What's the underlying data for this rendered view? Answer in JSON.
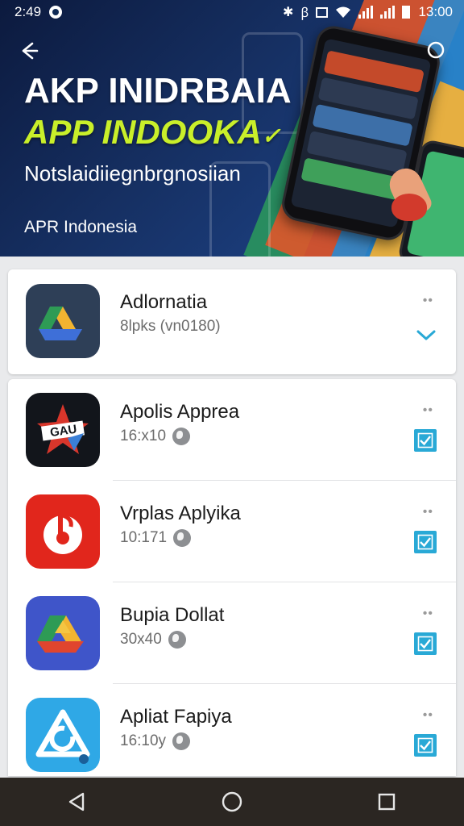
{
  "status_bar": {
    "time": "2:49",
    "clock": "13:00"
  },
  "banner": {
    "title_line_1": "AKP INIDRBAIA",
    "title_line_2": "APP INDOOKA",
    "subtitle": "Notslaidiiegnbrgnosiian",
    "caption": "APR Indonesia"
  },
  "top_item": {
    "name": "Adlornatia",
    "meta": "8lpks (vn0180)",
    "more": "••",
    "icon": "drive-triangle-icon"
  },
  "apps": [
    {
      "name": "Apolis Apprea",
      "meta": "16:x10",
      "icon": "star-tag-icon",
      "checked": true
    },
    {
      "name": "Vrplas Aplyika",
      "meta": "10:171",
      "icon": "music-note-icon",
      "checked": true
    },
    {
      "name": "Bupia Dollat",
      "meta": "30x40",
      "icon": "drive-triangle-icon",
      "checked": true
    },
    {
      "name": "Apliat Fapiya",
      "meta": "16:10y",
      "icon": "triangle-clock-icon",
      "checked": true
    }
  ],
  "colors": {
    "accent": "#29a9d6",
    "banner_bg": "#163063",
    "title_green": "#c9ef2a",
    "nav_bg": "#2b2622"
  }
}
